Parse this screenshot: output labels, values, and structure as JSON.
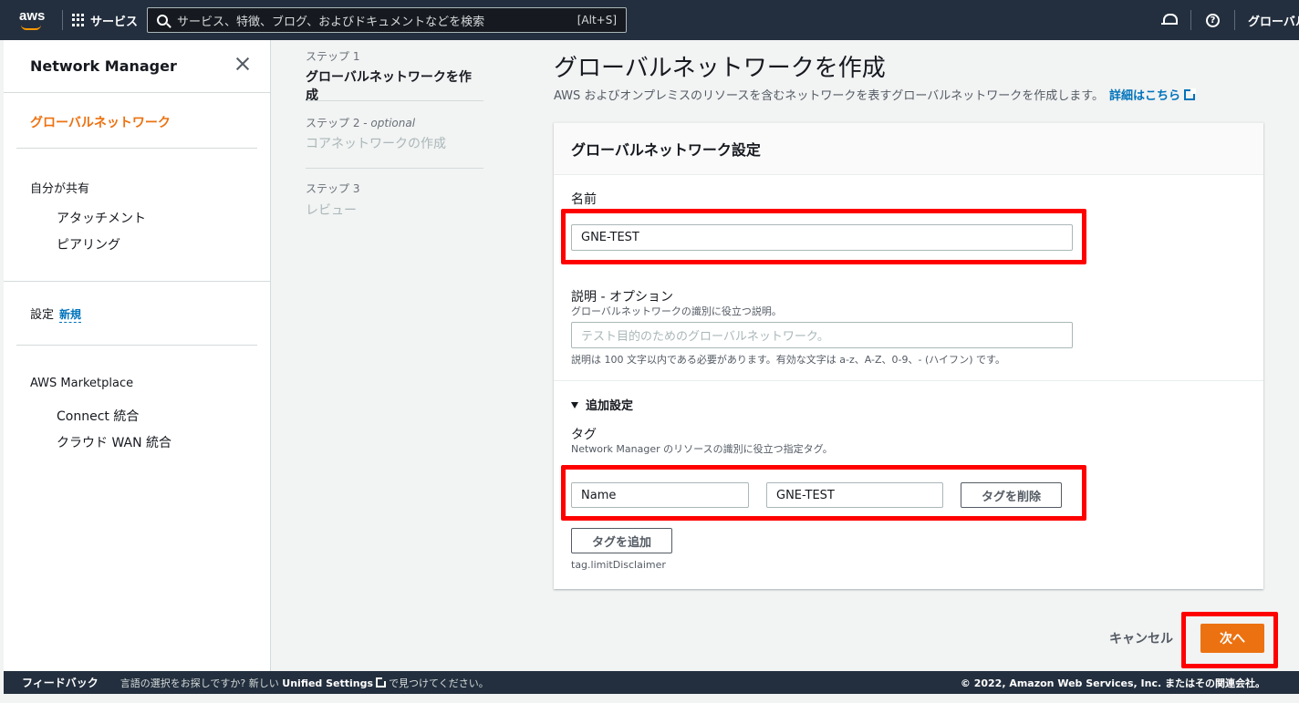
{
  "topnav": {
    "logo_text": "aws",
    "services_label": "サービス",
    "search_placeholder": "サービス、特徴、ブログ、およびドキュメントなどを検索",
    "search_shortcut": "[Alt+S]",
    "region_label": "グローバル"
  },
  "sidebar": {
    "title": "Network Manager",
    "active_item": "グローバルネットワーク",
    "section_shared": "自分が共有",
    "shared_items": [
      "アタッチメント",
      "ピアリング"
    ],
    "settings_label": "設定",
    "settings_badge": "新規",
    "marketplace_label": "AWS Marketplace",
    "marketplace_items": [
      "Connect 統合",
      "クラウド WAN 統合"
    ]
  },
  "steps": [
    {
      "label": "ステップ 1",
      "optional": "",
      "title": "グローバルネットワークを作成",
      "active": true
    },
    {
      "label": "ステップ 2 - ",
      "optional": "optional",
      "title": "コアネットワークの作成",
      "active": false
    },
    {
      "label": "ステップ 3",
      "optional": "",
      "title": "レビュー",
      "active": false
    }
  ],
  "main": {
    "title": "グローバルネットワークを作成",
    "description": "AWS およびオンプレミスのリソースを含むネットワークを表すグローバルネットワークを作成します。",
    "learn_more": "詳細はこちら",
    "panel_title": "グローバルネットワーク設定",
    "name_label": "名前",
    "name_value": "GNE-TEST",
    "desc_label": "説明 - オプション",
    "desc_hint": "グローバルネットワークの識別に役立つ説明。",
    "desc_placeholder": "テスト目的のためのグローバルネットワーク。",
    "desc_constraint": "説明は 100 文字以内である必要があります。有効な文字は a-z、A-Z、0-9、- (ハイフン) です。",
    "additional_settings": "追加設定",
    "tags_label": "タグ",
    "tags_hint": "Network Manager のリソースの識別に役立つ指定タグ。",
    "tag_key": "Name",
    "tag_value": "GNE-TEST",
    "remove_tag": "タグを削除",
    "add_tag": "タグを追加",
    "tag_disclaimer": "tag.limitDisclaimer",
    "cancel": "キャンセル",
    "next": "次へ"
  },
  "footer": {
    "feedback": "フィードバック",
    "note_prefix": "言語の選択をお探しですか? 新しい",
    "note_link": "Unified Settings",
    "note_suffix": "で見つけてください。",
    "copyright": "© 2022, Amazon Web Services, Inc. またはその関連会社。"
  },
  "colors": {
    "accent": "#ec7211",
    "link": "#0073bb",
    "nav_bg": "#232f3e",
    "highlight": "#ff0000"
  }
}
